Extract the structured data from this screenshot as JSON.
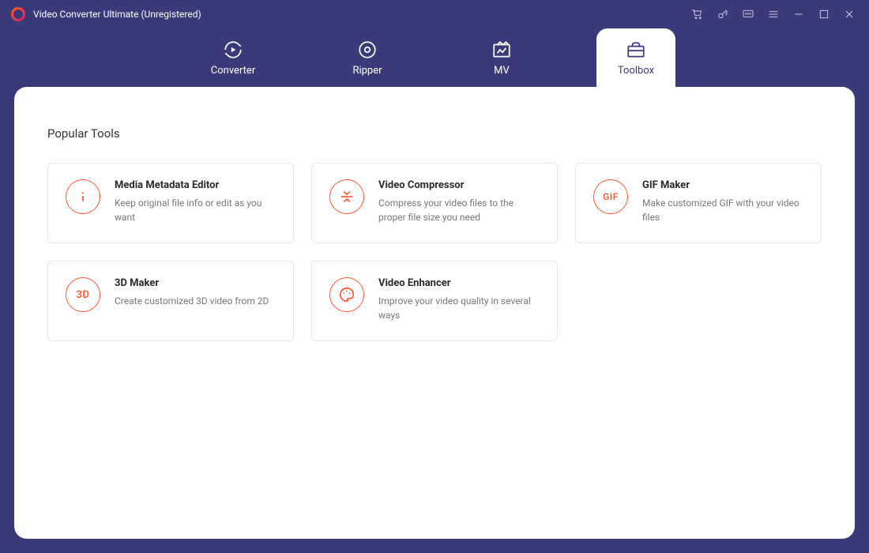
{
  "app": {
    "title": "Video Converter Ultimate (Unregistered)"
  },
  "titlebar_icons": [
    "cart",
    "key",
    "feedback",
    "menu",
    "minimize",
    "maximize",
    "close"
  ],
  "nav": {
    "tabs": [
      {
        "id": "converter",
        "label": "Converter",
        "icon": "converter",
        "active": false
      },
      {
        "id": "ripper",
        "label": "Ripper",
        "icon": "ripper",
        "active": false
      },
      {
        "id": "mv",
        "label": "MV",
        "icon": "mv",
        "active": false
      },
      {
        "id": "toolbox",
        "label": "Toolbox",
        "icon": "toolbox",
        "active": true
      }
    ]
  },
  "section": {
    "title": "Popular Tools"
  },
  "tools": [
    {
      "id": "metadata",
      "icon": "info",
      "title": "Media Metadata Editor",
      "desc": "Keep original file info or edit as you want"
    },
    {
      "id": "compressor",
      "icon": "compress",
      "title": "Video Compressor",
      "desc": "Compress your video files to the proper file size you need"
    },
    {
      "id": "gif",
      "icon": "gif-text",
      "title": "GIF Maker",
      "desc": "Make customized GIF with your video files"
    },
    {
      "id": "3d",
      "icon": "3d-text",
      "title": "3D Maker",
      "desc": "Create customized 3D video from 2D"
    },
    {
      "id": "enhancer",
      "icon": "palette",
      "title": "Video Enhancer",
      "desc": "Improve your video quality in several ways"
    }
  ],
  "colors": {
    "accent": "#ff5530",
    "header": "#3a3a7a"
  }
}
